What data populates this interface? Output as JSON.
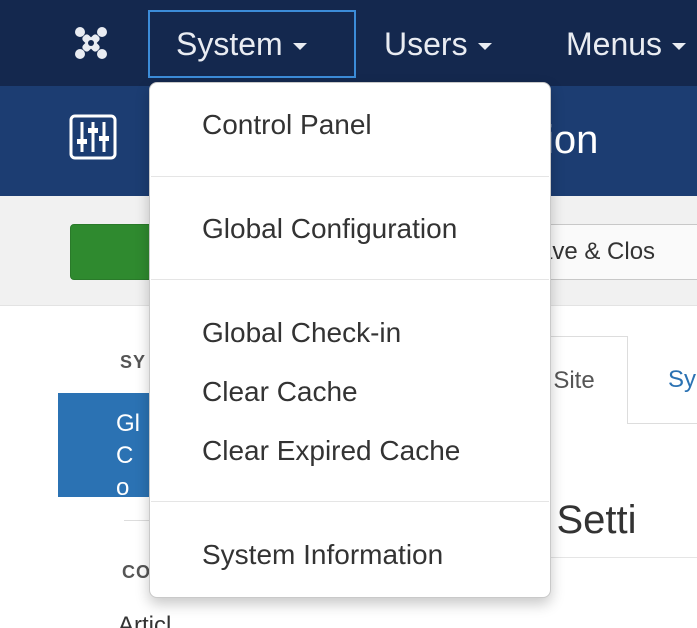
{
  "navbar": {
    "logo_icon": "joomla-logo-icon",
    "items": [
      {
        "label": "System",
        "active": true
      },
      {
        "label": "Users"
      },
      {
        "label": "Menus"
      }
    ]
  },
  "subhead": {
    "icon": "equalizer-sliders-icon",
    "title": "ion"
  },
  "toolbar": {
    "save_close_label": "ave & Clos"
  },
  "sidebar": {
    "heading_1": "SY",
    "active_item": "Gl Co",
    "heading_2": "CO",
    "link": "Articl"
  },
  "tabs": {
    "site": "Site",
    "system": "Sy"
  },
  "section": {
    "title": "te Setti"
  },
  "dropdown": {
    "items": [
      "Control Panel",
      "Global Configuration",
      "Global Check-in",
      "Clear Cache",
      "Clear Expired Cache",
      "System Information"
    ]
  },
  "colors": {
    "navbar_bg": "#14284e",
    "subhead_bg": "#1c3d72",
    "active_blue": "#2b72b3",
    "save_green": "#2f8a2f",
    "focus_border": "#3c8cd8"
  }
}
